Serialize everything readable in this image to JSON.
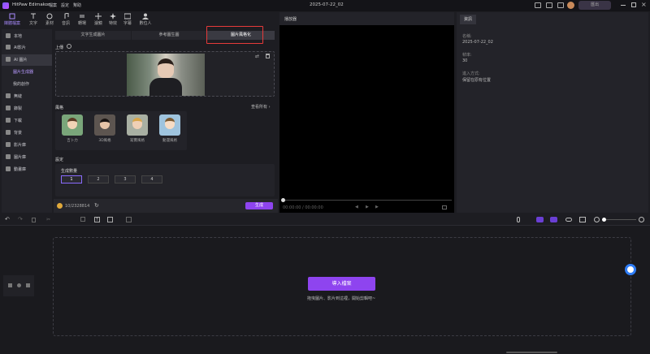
{
  "app": {
    "title": "HitPaw Edimakor",
    "menus": [
      "檔案",
      "設定",
      "幫助"
    ],
    "project": "2025-07-22_02",
    "export_label": "匯出"
  },
  "toolbar": {
    "items": [
      "媒體檔案",
      "文字",
      "素材",
      "音訊",
      "轉場",
      "濾鏡",
      "特效",
      "字幕",
      "數位人"
    ]
  },
  "sidebar": {
    "items": [
      "本地",
      "AI影片",
      "AI 圖片",
      "圖片生成器",
      "我的創作",
      "無縫",
      "錄製",
      "下載",
      "背景",
      "影片庫",
      "圖片庫",
      "動畫庫"
    ]
  },
  "ai": {
    "tabs": [
      "文字生成圖片",
      "參考圖生圖",
      "圖片風格化"
    ],
    "upload_label": "上傳",
    "styles_label": "風格",
    "view_all": "查看所有",
    "styles": [
      "吉卜力",
      "3D風格",
      "寫實風格",
      "動漫風格"
    ],
    "settings_label": "設定",
    "gen_count_label": "生成數量",
    "counts": [
      "1",
      "2",
      "3",
      "4"
    ],
    "credits": "10/2328814",
    "generate": "生成"
  },
  "preview": {
    "title": "播放器",
    "time": "00:00:00 / 00:00:00"
  },
  "props": {
    "tab": "資訊",
    "name_label": "名稱:",
    "name": "2025-07-22_02",
    "fps_label": "幀率:",
    "fps": "30",
    "import_label": "進入方式:",
    "import": "保留在原有位置"
  },
  "timeline": {
    "import_button": "導入檔案",
    "hint": "拖曳圖片、影片到這裡，開始剪輯吧~"
  },
  "colors": {
    "accent": "#9b59f5",
    "bg": "#1d1d22",
    "panel": "#232329"
  }
}
